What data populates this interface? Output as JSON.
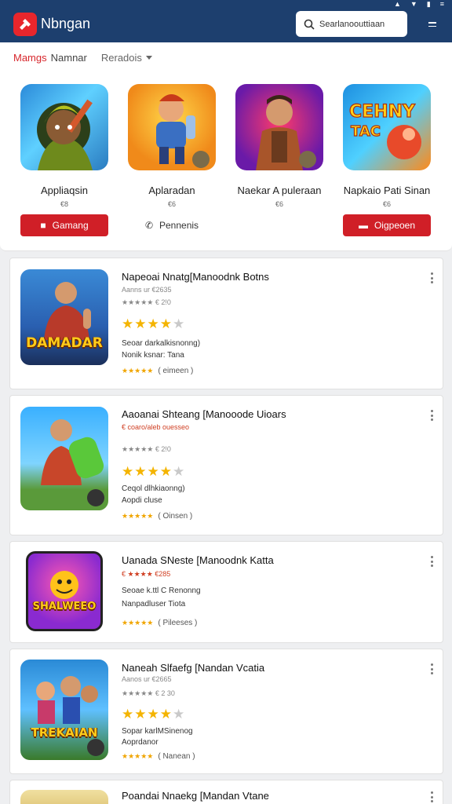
{
  "header": {
    "app_title": "Nbngan",
    "search_placeholder": "Searlanoouttiaan",
    "status_icons": [
      "wifi-icon",
      "signal-icon",
      "battery-icon",
      "lock-icon"
    ]
  },
  "tabs": {
    "active": "Mamgs",
    "second": "Namnar",
    "dropdown": "Reradois"
  },
  "featured": [
    {
      "name": "Appliaqsin",
      "sub": "€8"
    },
    {
      "name": "Aplaradan",
      "sub": "€6"
    },
    {
      "name": "Naekar A puleraan",
      "sub": "€6"
    },
    {
      "name": "Napkaio Pati Sinan",
      "sub": "€6"
    }
  ],
  "featured_buttons": [
    {
      "label": "Gamang",
      "style": "red"
    },
    {
      "label": "Pennenis",
      "style": "plain"
    },
    {
      "label": "",
      "style": "none"
    },
    {
      "label": "Oigpeoen",
      "style": "red"
    }
  ],
  "list": [
    {
      "title": "Napeoai Nnatg[Manoodnk Botns",
      "meta1": "Aanns ur €2635",
      "meta2": "★★★★★ € 2!0",
      "stars": 4,
      "desc1": "Seoar darkalkisnonng)",
      "desc2": "Nonik ksnar:  Tana",
      "rate_label": "( eimeen )",
      "art": "DAMADAR"
    },
    {
      "title": "Aaoanai Shteang [Manooode Uioars",
      "meta1": "€ coaro/aleb ouesseo",
      "meta2": "★★★★★ € 2!0",
      "stars": 4,
      "desc1": "Ceqol dlhkiaonng)",
      "desc2": "Aopdi cluse",
      "rate_label": "( Oinsen )",
      "art": ""
    },
    {
      "title": "Uanada SNeste [Manoodnk Katta",
      "meta1": "€ ★★★★  €285",
      "meta2": "",
      "stars": 0,
      "desc1": "Seoae k.ttl C Renonng",
      "desc2": "Nanpadluser  Tiota",
      "rate_label": "( Pileeses )",
      "art": "SHALWEEO"
    },
    {
      "title": "Naneah Slfaefg [Nandan Vcatia",
      "meta1": "Aanos ur €2665",
      "meta2": "★★★★★ € 2 30",
      "stars": 4,
      "desc1": "Sopar karlMSinenog",
      "desc2": "Aoprdanor",
      "rate_label": "( Nanean )",
      "art": "TREKAIAN"
    },
    {
      "title": "Poandai Nnaekg [Mandan Vtane",
      "meta1": "",
      "meta2": "",
      "stars": 0,
      "desc1": "",
      "desc2": "",
      "rate_label": "",
      "art": ""
    }
  ],
  "colors": {
    "header_bg": "#1d3f6e",
    "accent_red": "#d01f27",
    "star": "#f4b400"
  }
}
